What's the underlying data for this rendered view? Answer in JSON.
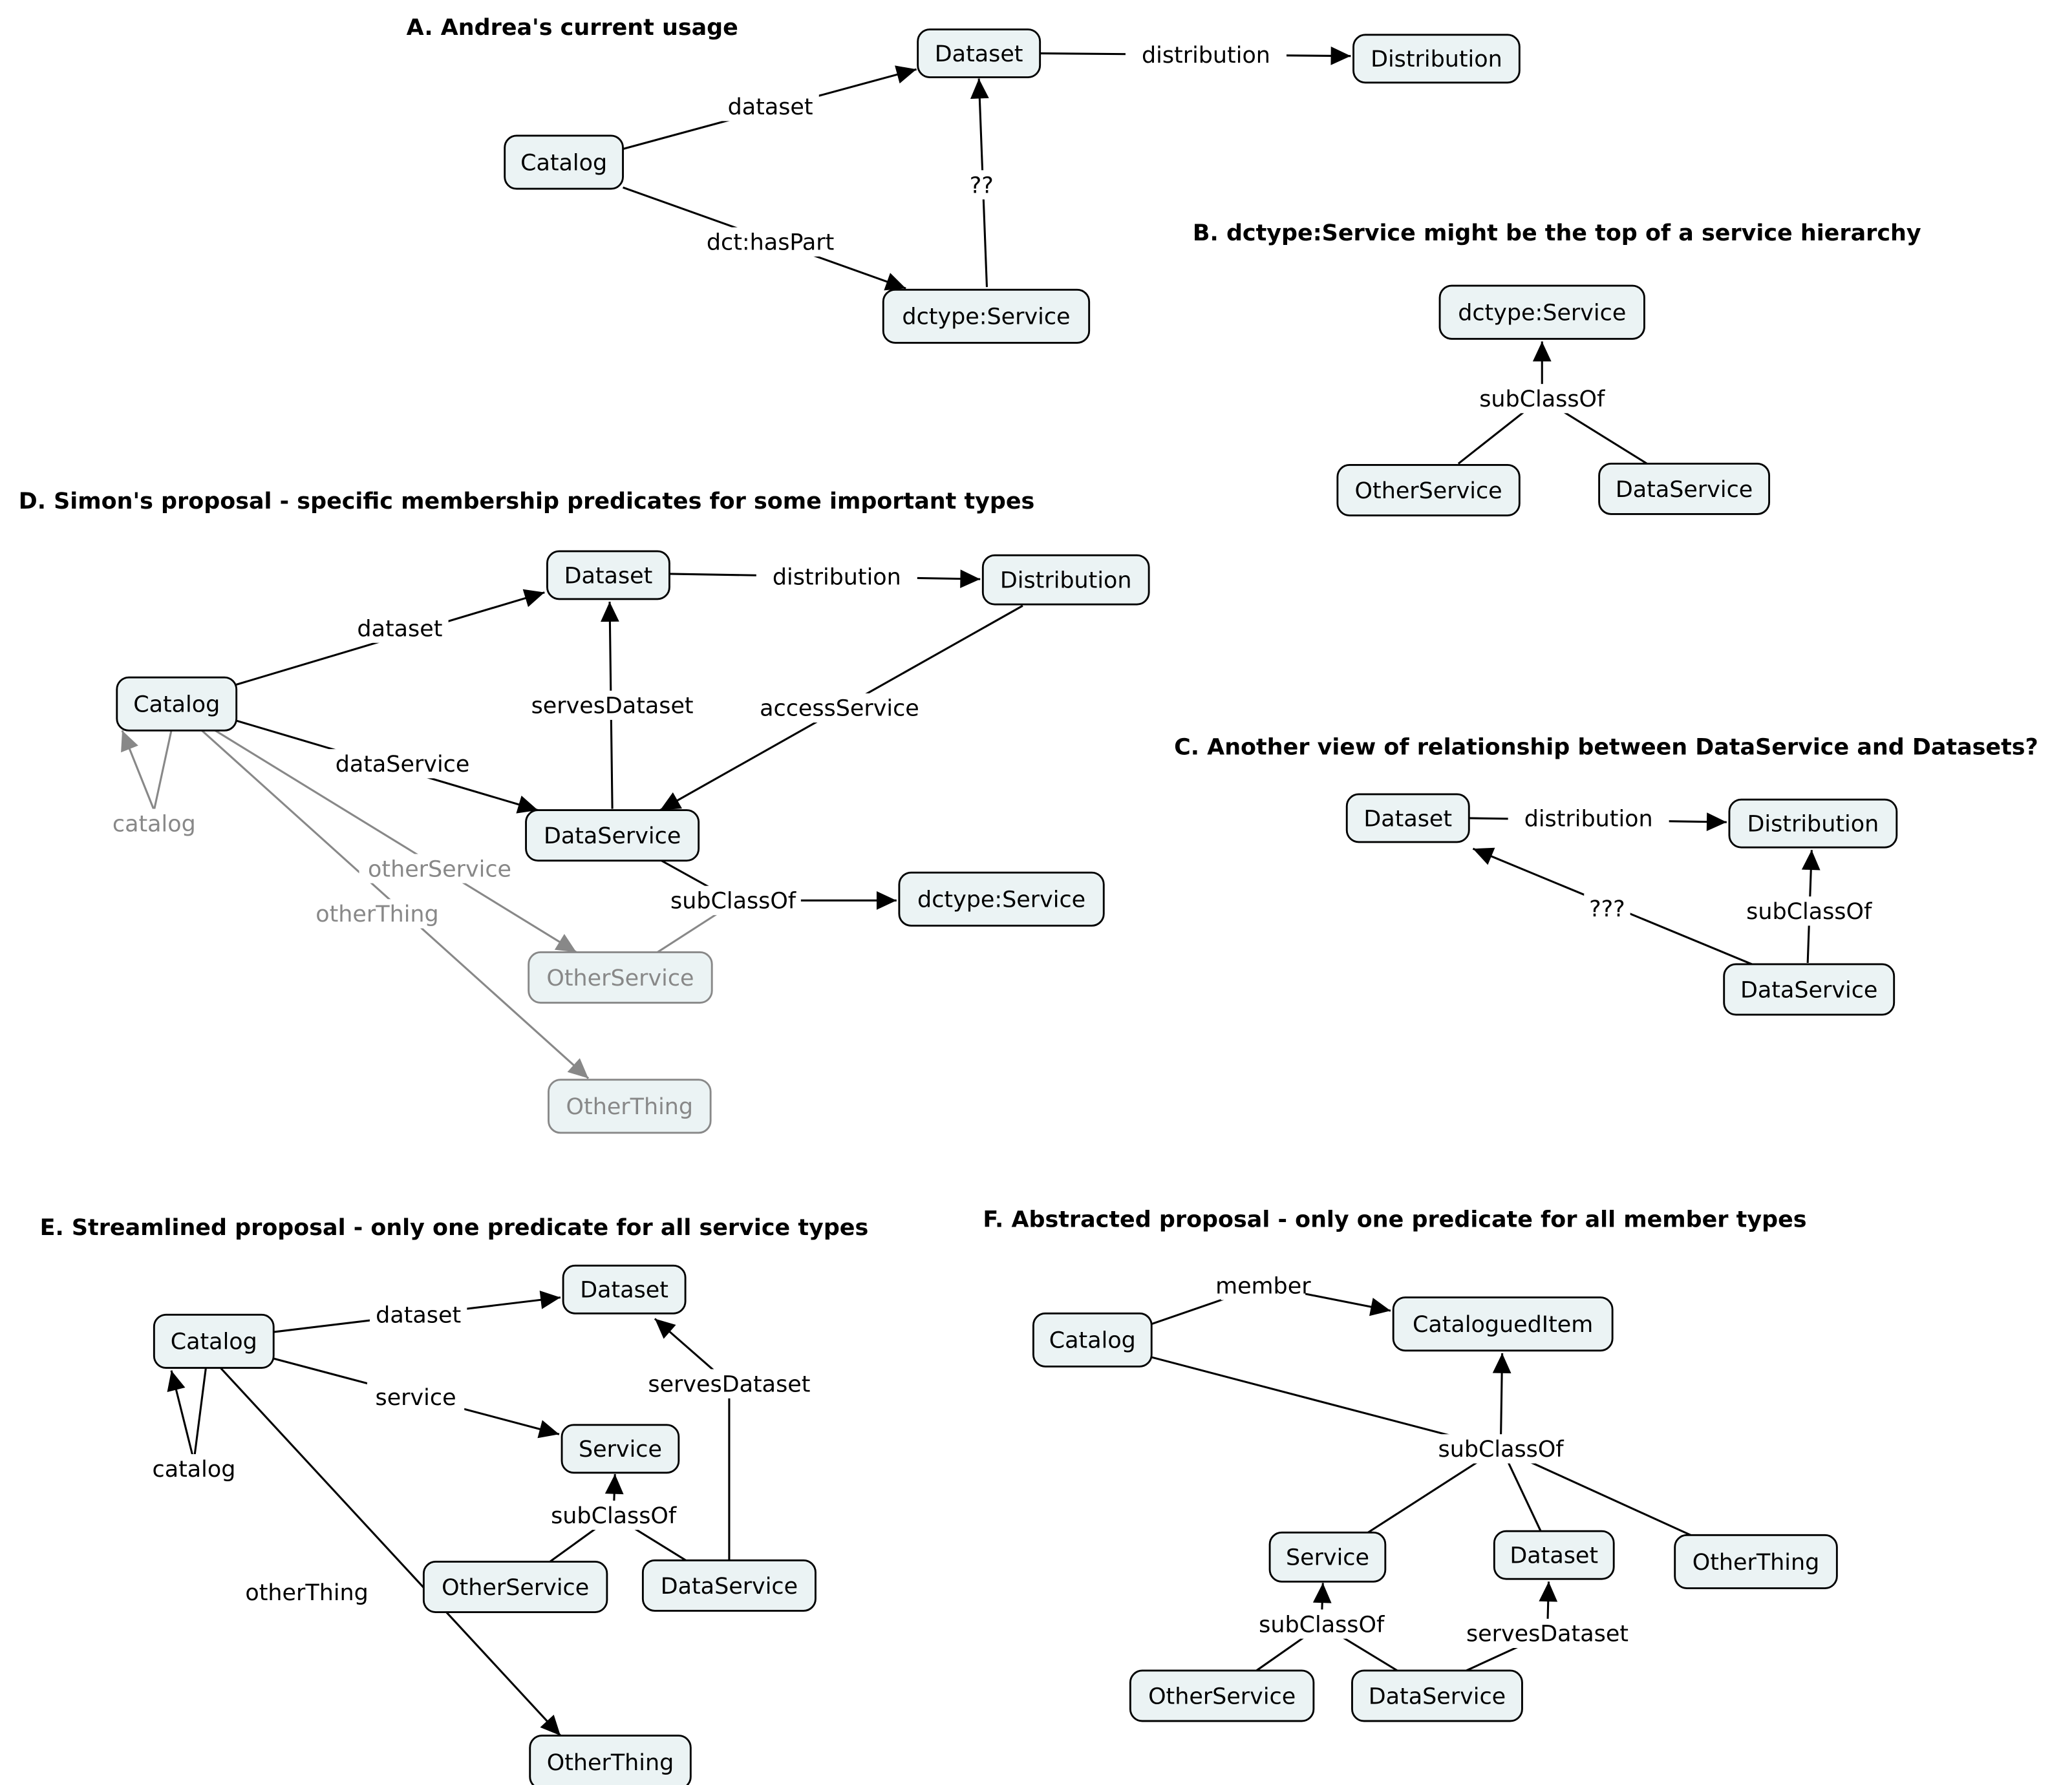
{
  "titles": {
    "A": "A. Andrea's current usage",
    "B": "B. dctype:Service might be the top of a service hierarchy",
    "C": "C. Another view of relationship between DataService and Datasets?",
    "D": "D. Simon's proposal - specific membership predicates for some important types",
    "E": "E. Streamlined proposal - only one predicate for all service types",
    "F": "F. Abstracted proposal - only one predicate for all member types"
  },
  "nodes": {
    "A_catalog": "Catalog",
    "A_dataset": "Dataset",
    "A_distribution": "Distribution",
    "A_service": "dctype:Service",
    "B_service": "dctype:Service",
    "B_other": "OtherService",
    "B_data": "DataService",
    "C_dataset": "Dataset",
    "C_distribution": "Distribution",
    "C_dataservice": "DataService",
    "D_catalog": "Catalog",
    "D_dataset": "Dataset",
    "D_distribution": "Distribution",
    "D_dataservice": "DataService",
    "D_dctype": "dctype:Service",
    "D_otherservice": "OtherService",
    "D_otherthing": "OtherThing",
    "E_catalog": "Catalog",
    "E_dataset": "Dataset",
    "E_service": "Service",
    "E_otherservice": "OtherService",
    "E_dataservice": "DataService",
    "E_otherthing": "OtherThing",
    "F_catalog": "Catalog",
    "F_item": "CataloguedItem",
    "F_service": "Service",
    "F_dataset": "Dataset",
    "F_otherthing": "OtherThing",
    "F_otherservice": "OtherService",
    "F_dataservice": "DataService"
  },
  "edges": {
    "A_dataset": "dataset",
    "A_haspart": "dct:hasPart",
    "A_q": "??",
    "A_distribution": "distribution",
    "B_subclass": "subClassOf",
    "C_distribution": "distribution",
    "C_q": "???",
    "C_subclass": "subClassOf",
    "D_dataset": "dataset",
    "D_distribution": "distribution",
    "D_serves": "servesDataset",
    "D_access": "accessService",
    "D_dataservice": "dataService",
    "D_catalog": "catalog",
    "D_otherservice": "otherService",
    "D_otherthing": "otherThing",
    "D_subclass": "subClassOf",
    "E_dataset": "dataset",
    "E_service": "service",
    "E_catalog": "catalog",
    "E_otherthing": "otherThing",
    "E_serves": "servesDataset",
    "E_subclass": "subClassOf",
    "F_member": "member",
    "F_subclass": "subClassOf",
    "F_subclass2": "subClassOf",
    "F_serves": "servesDataset"
  },
  "colors": {
    "node_fill": "#ebf3f4",
    "muted": "#888888",
    "line": "#000000"
  }
}
